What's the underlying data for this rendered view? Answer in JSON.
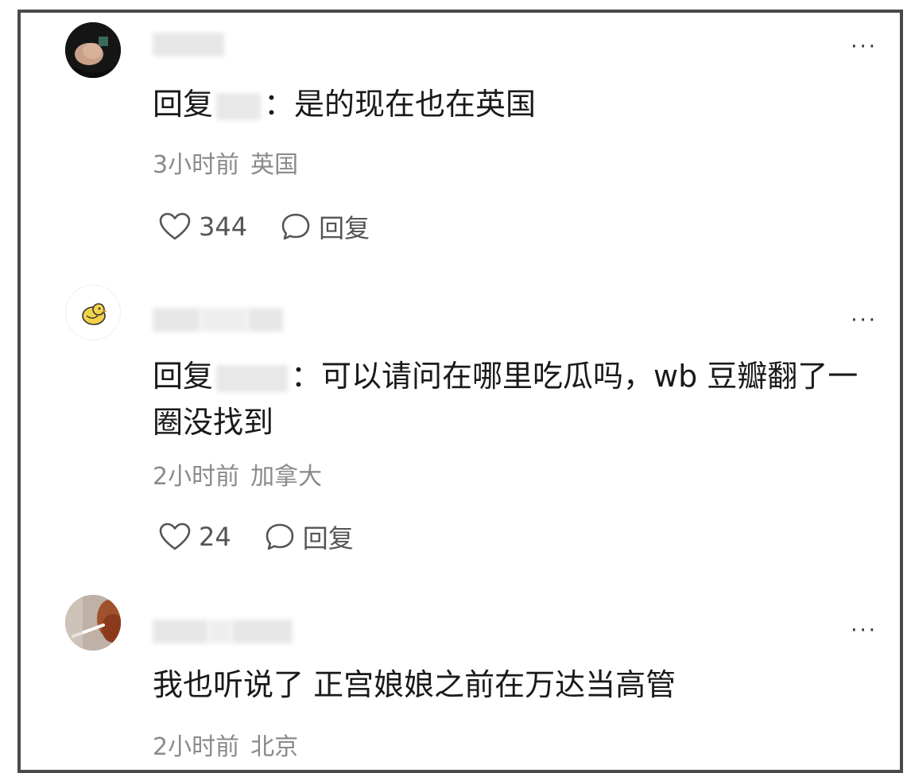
{
  "comments": [
    {
      "reply_prefix": "回复",
      "text": "：是的现在也在英国",
      "time": "3小时前",
      "location": "英国",
      "likes": "344",
      "reply_label": "回复"
    },
    {
      "reply_prefix": "回复",
      "text": "：可以请问在哪里吃瓜吗，wb 豆瓣翻了一圈没找到",
      "time": "2小时前",
      "location": "加拿大",
      "likes": "24",
      "reply_label": "回复"
    },
    {
      "reply_prefix": "",
      "text": "我也听说了 正宫娘娘之前在万达当高管",
      "time": "2小时前",
      "location": "北京"
    }
  ],
  "more_label": "···",
  "icons": {
    "like": "heart-outline-icon",
    "reply": "speech-bubble-icon",
    "more": "more-dots-icon"
  }
}
